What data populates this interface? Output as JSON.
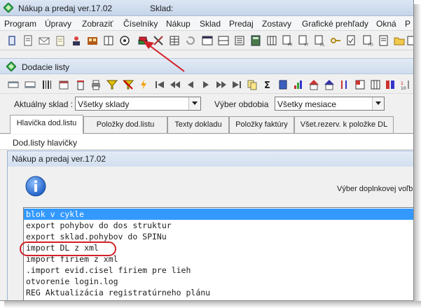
{
  "window": {
    "title": "Nákup a predaj ver.17.02",
    "sklad_label": "Sklad:"
  },
  "menu": {
    "items": [
      "Program",
      "Úpravy",
      "Zobraziť",
      "Číselníky",
      "Nákup",
      "Sklad",
      "Predaj",
      "Zostavy",
      "Grafické prehľady",
      "Okná",
      "P"
    ]
  },
  "child_window": {
    "title": "Dodacie listy"
  },
  "filters": {
    "sklad_label": "Aktuálny sklad :",
    "sklad_value": "Všetky sklady",
    "obdobie_label": "Výber obdobia",
    "obdobie_value": "Všetky mesiace"
  },
  "tabs": [
    {
      "label": "Hlavička dod.listu",
      "active": true
    },
    {
      "label": "Položky dod.listu",
      "active": false
    },
    {
      "label": "Texty dokladu",
      "active": false
    },
    {
      "label": "Položky faktúry",
      "active": false
    },
    {
      "label": "Všet.rezerv. k položke DL",
      "active": false
    }
  ],
  "section": {
    "label": "Dod.listy hlavičky"
  },
  "dialog": {
    "title": "Nákup a predaj ver.17.02",
    "prompt": "Výber doplnkovej voľb",
    "options": [
      {
        "label": "blok v cykle",
        "selected": true
      },
      {
        "label": "export pohybov do dos struktur",
        "selected": false
      },
      {
        "label": "export sklad.pohybov do SPINu",
        "selected": false
      },
      {
        "label": "import DL z xml",
        "selected": false
      },
      {
        "label": "import firiem z xml",
        "selected": false
      },
      {
        "label": ".import evid.cisel firiem  pre lieh",
        "selected": false
      },
      {
        "label": "otvorenie login.log",
        "selected": false
      },
      {
        "label": "REG Aktualizácia registratúrneho plánu",
        "selected": false
      }
    ]
  },
  "colors": {
    "selection": "#3399ff",
    "annotation_red": "#d2202a"
  }
}
